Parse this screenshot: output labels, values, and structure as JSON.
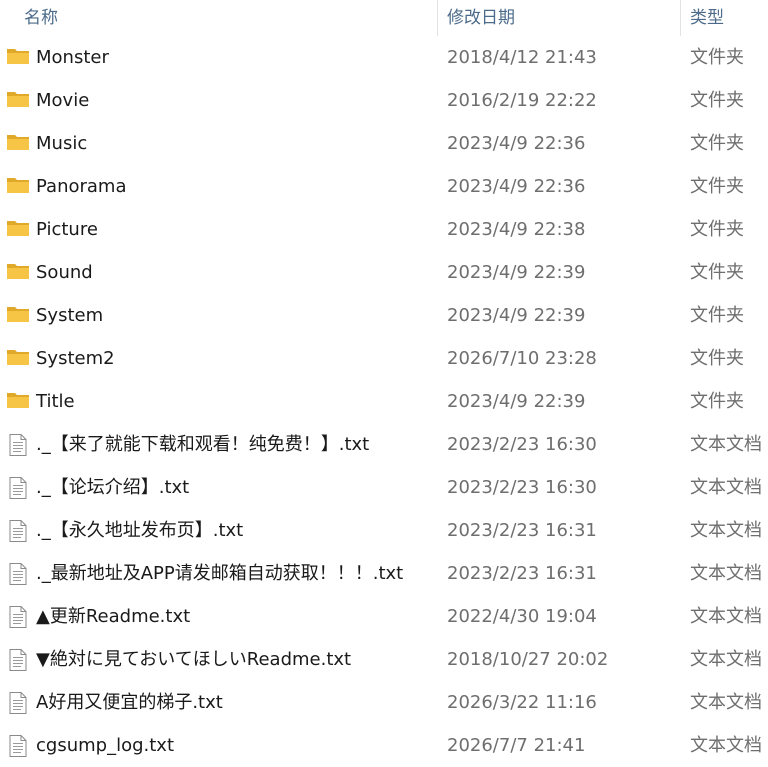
{
  "header": {
    "name_label": "名称",
    "date_label": "修改日期",
    "type_label": "类型",
    "sort_indicator": "^"
  },
  "colors": {
    "folder": "#f6c545",
    "folder_dark": "#e0a92a",
    "header_text": "#4c6b8a"
  },
  "files": [
    {
      "name": "Monster",
      "date": "2018/4/12 21:43",
      "type": "文件夹",
      "icon": "folder-icon"
    },
    {
      "name": "Movie",
      "date": "2016/2/19 22:22",
      "type": "文件夹",
      "icon": "folder-icon"
    },
    {
      "name": "Music",
      "date": "2023/4/9 22:36",
      "type": "文件夹",
      "icon": "folder-icon"
    },
    {
      "name": "Panorama",
      "date": "2023/4/9 22:36",
      "type": "文件夹",
      "icon": "folder-icon"
    },
    {
      "name": "Picture",
      "date": "2023/4/9 22:38",
      "type": "文件夹",
      "icon": "folder-icon"
    },
    {
      "name": "Sound",
      "date": "2023/4/9 22:39",
      "type": "文件夹",
      "icon": "folder-icon"
    },
    {
      "name": "System",
      "date": "2023/4/9 22:39",
      "type": "文件夹",
      "icon": "folder-icon"
    },
    {
      "name": "System2",
      "date": "2026/7/10 23:28",
      "type": "文件夹",
      "icon": "folder-icon"
    },
    {
      "name": "Title",
      "date": "2023/4/9 22:39",
      "type": "文件夹",
      "icon": "folder-icon"
    },
    {
      "name": "._【来了就能下载和观看！纯免费！】.txt",
      "date": "2023/2/23 16:30",
      "type": "文本文档",
      "icon": "text-file-icon"
    },
    {
      "name": "._【论坛介绍】.txt",
      "date": "2023/2/23 16:30",
      "type": "文本文档",
      "icon": "text-file-icon"
    },
    {
      "name": "._【永久地址发布页】.txt",
      "date": "2023/2/23 16:31",
      "type": "文本文档",
      "icon": "text-file-icon"
    },
    {
      "name": "._最新地址及APP请发邮箱自动获取！！！.txt",
      "date": "2023/2/23 16:31",
      "type": "文本文档",
      "icon": "text-file-icon"
    },
    {
      "name": "▲更新Readme.txt",
      "date": "2022/4/30 19:04",
      "type": "文本文档",
      "icon": "text-file-icon"
    },
    {
      "name": "▼絶対に見ておいてほしいReadme.txt",
      "date": "2018/10/27 20:02",
      "type": "文本文档",
      "icon": "text-file-icon"
    },
    {
      "name": "A好用又便宜的梯子.txt",
      "date": "2026/3/22 11:16",
      "type": "文本文档",
      "icon": "text-file-icon"
    },
    {
      "name": "cgsump_log.txt",
      "date": "2026/7/7 21:41",
      "type": "文本文档",
      "icon": "text-file-icon"
    }
  ]
}
